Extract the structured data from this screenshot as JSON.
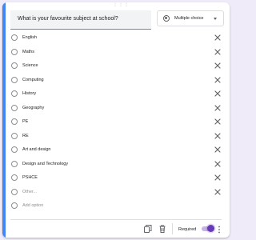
{
  "question": {
    "text": "What is your favourite subject at school?"
  },
  "question_type": {
    "label": "Multiple choice",
    "icon": "radio-button-icon"
  },
  "options": [
    {
      "label": "English"
    },
    {
      "label": "Maths"
    },
    {
      "label": "Science"
    },
    {
      "label": "Computing"
    },
    {
      "label": "History"
    },
    {
      "label": "Geography"
    },
    {
      "label": "PE"
    },
    {
      "label": "RE"
    },
    {
      "label": "Art and design"
    },
    {
      "label": "Design and Technology"
    },
    {
      "label": "PSHCE"
    }
  ],
  "other_option": {
    "label": "Other..."
  },
  "add_option": {
    "label": "Add option"
  },
  "footer": {
    "required_label": "Required",
    "required_on": true,
    "icons": [
      "duplicate-icon",
      "delete-icon",
      "more-vertical-icon"
    ]
  },
  "colors": {
    "accent": "#4285f4",
    "toggle": "#673ab7",
    "background": "#f0ebf8"
  }
}
